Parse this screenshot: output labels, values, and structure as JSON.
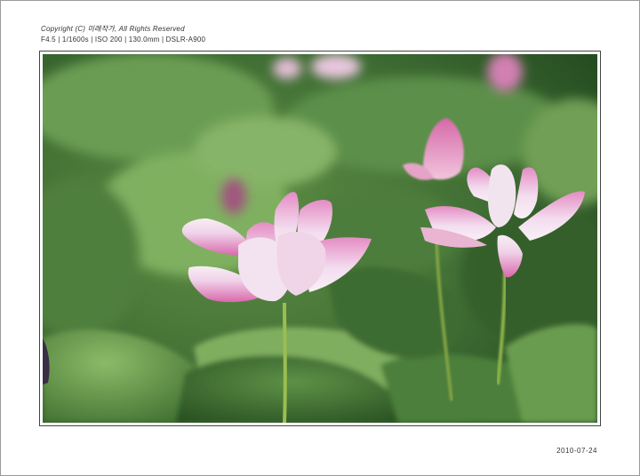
{
  "header": {
    "copyright": "Copyright (C) 미래작가, All Rights Reserved",
    "exif": "F4.5 | 1/1600s | ISO 200 | 130.0mm | DSLR-A900"
  },
  "footer": {
    "date": "2010-07-24"
  },
  "photo": {
    "subject": "lotus-flowers",
    "palette": {
      "leaf_dark": "#2f5a26",
      "leaf_light": "#7fae5e",
      "petal_pink": "#d96fae",
      "petal_white": "#f6eef6",
      "stem": "#8fb34a"
    }
  }
}
